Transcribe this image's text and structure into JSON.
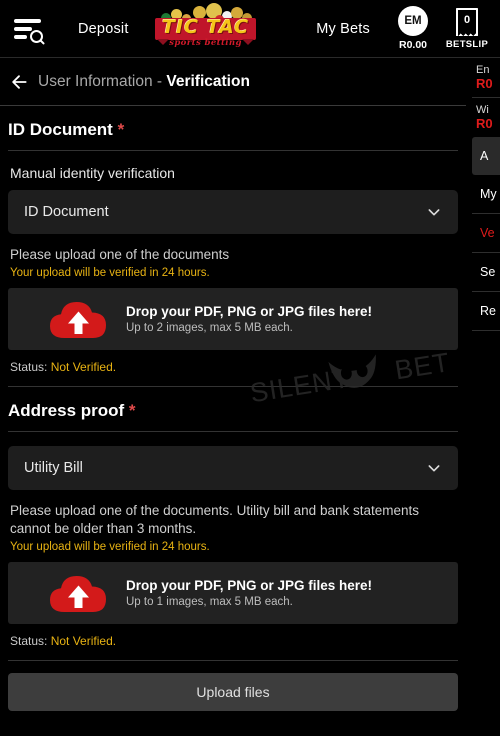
{
  "header": {
    "menu_search_icon": "menu-search-icon",
    "deposit_label": "Deposit",
    "my_bets_label": "My Bets",
    "logo_main": "TIC TAC",
    "logo_sub": "sports betting",
    "avatar_initials": "EM",
    "avatar_balance": "R0.00",
    "betslip_count": "0",
    "betslip_label": "BETSLIP"
  },
  "titlebar": {
    "back_icon": "back-arrow-icon",
    "prefix": "User Information - ",
    "page": "Verification"
  },
  "id_document": {
    "section_title": "ID Document",
    "required_mark": "*",
    "sub_label": "Manual identity verification",
    "select_value": "ID Document",
    "help_text": "Please upload one of the documents",
    "warn_text": "Your upload will be verified in 24 hours.",
    "drop_main": "Drop your PDF, PNG or JPG files here!",
    "drop_sub": "Up to 2 images, max 5 MB each.",
    "status_label": "Status:",
    "status_value": "Not Verified."
  },
  "address_proof": {
    "section_title": "Address proof",
    "required_mark": "*",
    "select_value": "Utility Bill",
    "help_text": "Please upload one of the documents. Utility bill and bank statements cannot be older than 3 months.",
    "warn_text": "Your upload will be verified in 24 hours.",
    "drop_main": "Drop your PDF, PNG or JPG files here!",
    "drop_sub": "Up to 1 images, max 5 MB each.",
    "status_label": "Status:",
    "status_value": "Not Verified."
  },
  "footer": {
    "upload_button": "Upload files"
  },
  "sidebar": {
    "balance1_label": "En",
    "balance1_amount": "R0",
    "balance2_label": "Wi",
    "balance2_amount": "R0",
    "items": [
      {
        "label": "A",
        "state": "active"
      },
      {
        "label": "My",
        "state": "normal"
      },
      {
        "label": "Ve",
        "state": "selected"
      },
      {
        "label": "Se",
        "state": "normal"
      },
      {
        "label": "Re",
        "state": "normal"
      }
    ]
  },
  "watermark": {
    "text_left": "SILENT",
    "text_right": "BET",
    "owl_icon": "owl-mask-icon"
  },
  "colors": {
    "background": "#000000",
    "panel": "#1e1e1e",
    "accent_red": "#d31a1a",
    "warn_amber": "#e8b313",
    "logo_gold": "#f5c518"
  }
}
